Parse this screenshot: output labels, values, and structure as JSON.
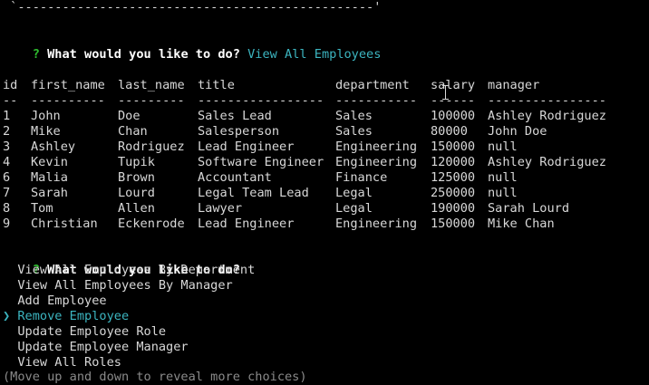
{
  "top_border": " `------------------------------------------------'",
  "prompt1": {
    "mark": "?",
    "question": "What would you like to do?",
    "answer": "View All Employees"
  },
  "table": {
    "columns": [
      "id",
      "first_name",
      "last_name",
      "title",
      "department",
      "salary",
      "manager"
    ],
    "separators": [
      "--",
      "----------",
      "---------",
      "-----------------",
      "-----------",
      "------",
      "----------------"
    ],
    "rows": [
      [
        "1",
        "John",
        "Doe",
        "Sales Lead",
        "Sales",
        "100000",
        "Ashley Rodriguez"
      ],
      [
        "2",
        "Mike",
        "Chan",
        "Salesperson",
        "Sales",
        "80000",
        "John Doe"
      ],
      [
        "3",
        "Ashley",
        "Rodriguez",
        "Lead Engineer",
        "Engineering",
        "150000",
        "null"
      ],
      [
        "4",
        "Kevin",
        "Tupik",
        "Software Engineer",
        "Engineering",
        "120000",
        "Ashley Rodriguez"
      ],
      [
        "6",
        "Malia",
        "Brown",
        "Accountant",
        "Finance",
        "125000",
        "null"
      ],
      [
        "7",
        "Sarah",
        "Lourd",
        "Legal Team Lead",
        "Legal",
        "250000",
        "null"
      ],
      [
        "8",
        "Tom",
        "Allen",
        "Lawyer",
        "Legal",
        "190000",
        "Sarah Lourd"
      ],
      [
        "9",
        "Christian",
        "Eckenrode",
        "Lead Engineer",
        "Engineering",
        "150000",
        "Mike Chan"
      ]
    ]
  },
  "prompt2": {
    "mark": "?",
    "question": "What would you like to do?",
    "pointer": "❯",
    "choices": [
      "View All Employees By Department",
      "View All Employees By Manager",
      "Add Employee",
      "Remove Employee",
      "Update Employee Role",
      "Update Employee Manager",
      "View All Roles"
    ],
    "selected": "Remove Employee",
    "hint": "(Move up and down to reveal more choices)"
  },
  "colors": {
    "background": "#000000",
    "text": "#d8d8d8",
    "question_mark": "#2fbf2f",
    "answer_accent": "#3cb5c0",
    "hint": "#8a8a8a"
  },
  "icons": {
    "pointer": "pointer-chevron-icon",
    "mouse_cursor": "text-cursor-icon"
  }
}
